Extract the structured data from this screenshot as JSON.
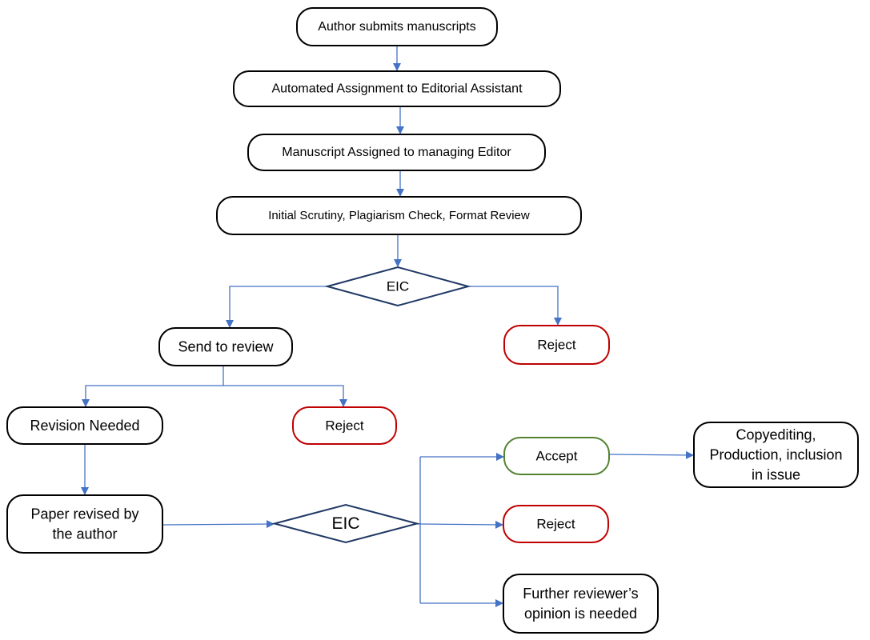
{
  "colors": {
    "edge": "#4472C4",
    "default_border": "#000000",
    "reject_border": "#C00000",
    "accept_border": "#548235",
    "decision_border": "#1F3864"
  },
  "nodes": {
    "submit": {
      "lines": [
        "Author submits manuscripts"
      ]
    },
    "auto_assign": {
      "lines": [
        "Automated Assignment to Editorial Assistant"
      ]
    },
    "managing_editor": {
      "lines": [
        "Manuscript Assigned to managing Editor"
      ]
    },
    "scrutiny": {
      "lines": [
        "Initial Scrutiny, Plagiarism Check, Format Review"
      ]
    },
    "eic1": {
      "lines": [
        "EIC"
      ]
    },
    "send_review": {
      "lines": [
        "Send to review"
      ]
    },
    "reject1": {
      "lines": [
        "Reject"
      ]
    },
    "revision": {
      "lines": [
        "Revision Needed"
      ]
    },
    "reject2": {
      "lines": [
        "Reject"
      ]
    },
    "revised": {
      "lines": [
        "Paper revised by",
        "the author"
      ]
    },
    "eic2": {
      "lines": [
        "EIC"
      ]
    },
    "accept": {
      "lines": [
        "Accept"
      ]
    },
    "reject3": {
      "lines": [
        "Reject"
      ]
    },
    "copyediting": {
      "lines": [
        "Copyediting,",
        "Production, inclusion",
        "in issue"
      ]
    },
    "further": {
      "lines": [
        "Further reviewer’s",
        "opinion is needed"
      ]
    }
  }
}
